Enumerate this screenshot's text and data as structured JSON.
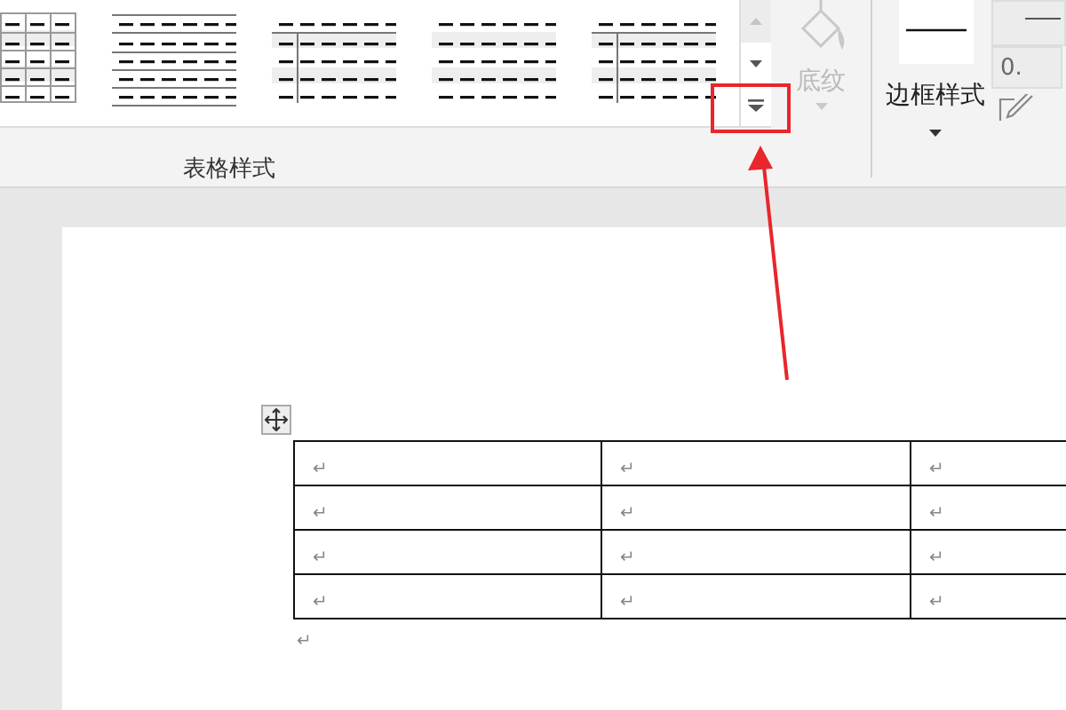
{
  "ribbon": {
    "table_styles": {
      "styles": [
        {
          "kind": "grid"
        },
        {
          "kind": "lines"
        },
        {
          "kind": "header-column"
        },
        {
          "kind": "banded"
        },
        {
          "kind": "header-column"
        }
      ],
      "group_label": "表格样式"
    },
    "shading": {
      "label": "底纹",
      "disabled": true
    },
    "borders": {
      "label": "边框样式",
      "weight": "0."
    }
  },
  "document": {
    "table": {
      "rows": [
        {
          "cells": [
            "↵",
            "↵",
            "↵"
          ]
        },
        {
          "cells": [
            "↵",
            "↵",
            "↵"
          ]
        },
        {
          "cells": [
            "↵",
            "↵",
            "↵"
          ]
        },
        {
          "cells": [
            "↵",
            "↵",
            "↵"
          ]
        }
      ]
    },
    "after_mark": "↵"
  }
}
